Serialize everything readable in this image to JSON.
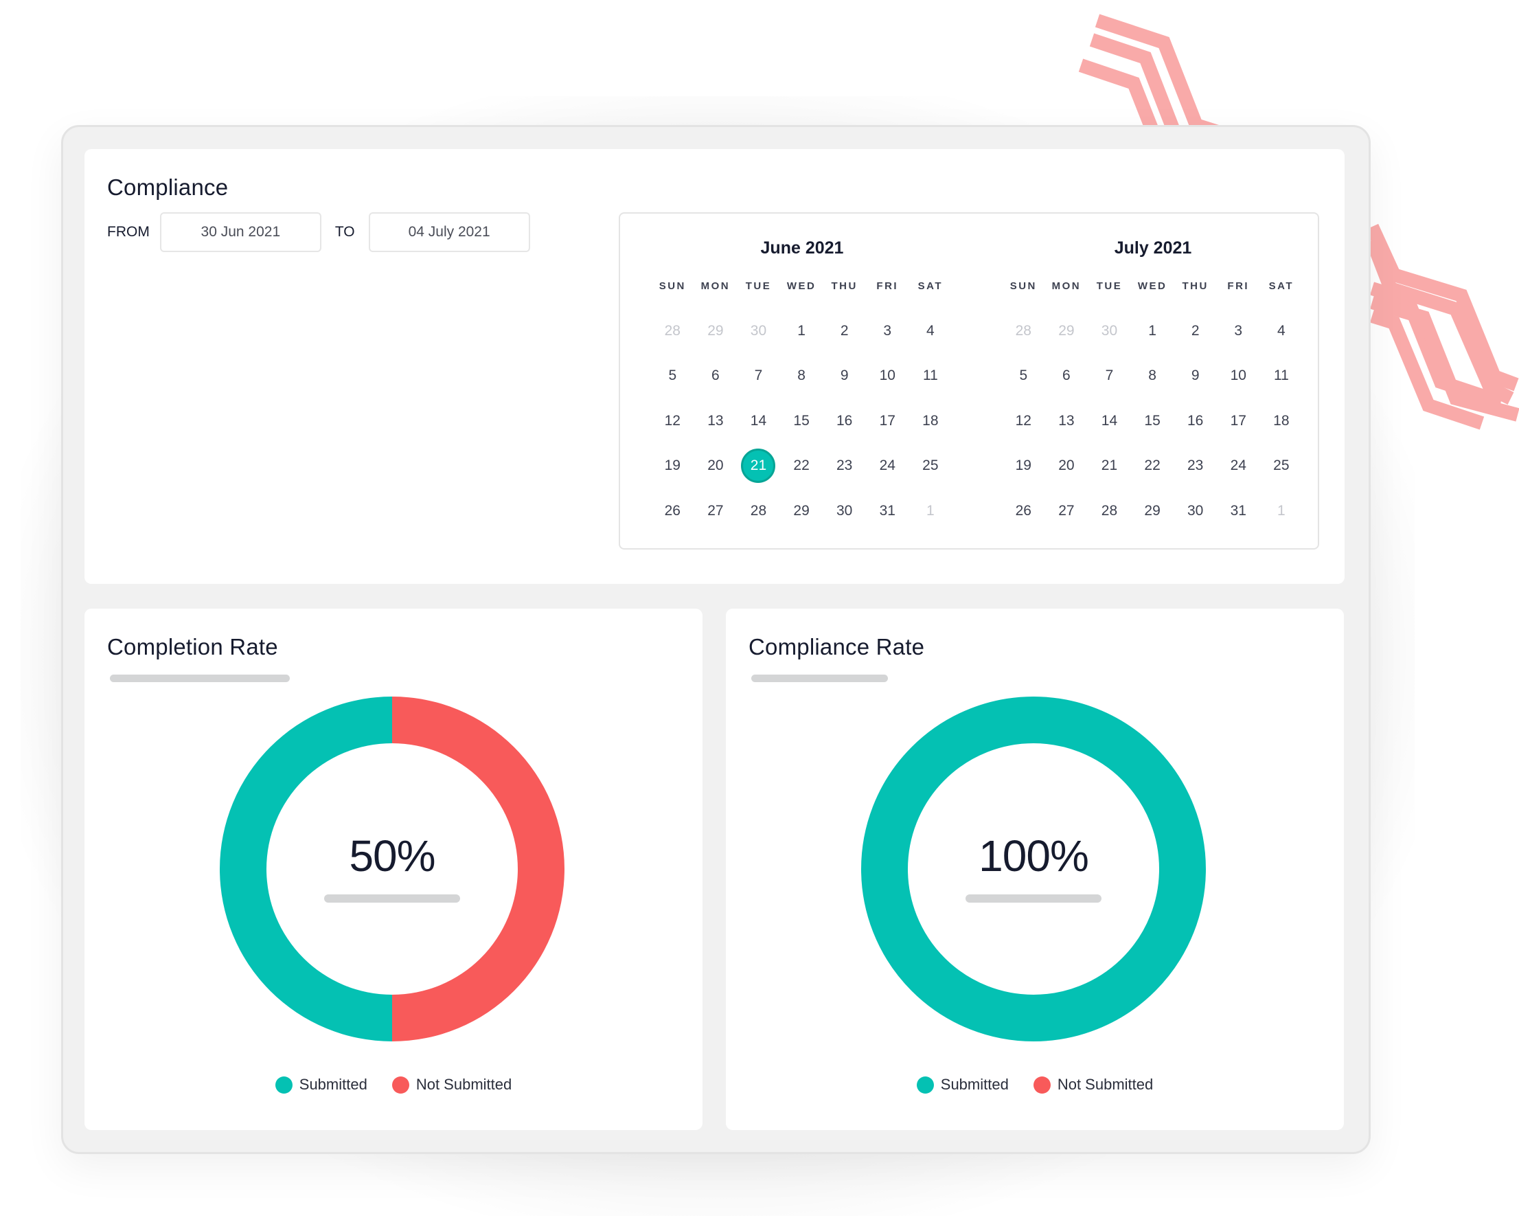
{
  "colors": {
    "accent": "#04c1b3",
    "negative": "#f85a5a",
    "decoration": "#f9aaa9",
    "text": "#161b2e"
  },
  "compliance": {
    "title": "Compliance",
    "from_label": "FROM",
    "from_value": "30 Jun 2021",
    "to_label": "TO",
    "to_value": "04 July 2021"
  },
  "calendar": {
    "weekdays": [
      "SUN",
      "MON",
      "TUE",
      "WED",
      "THU",
      "FRI",
      "SAT"
    ],
    "months": [
      {
        "title": "June 2021",
        "days": [
          {
            "d": "28",
            "muted": true
          },
          {
            "d": "29",
            "muted": true
          },
          {
            "d": "30",
            "muted": true
          },
          {
            "d": "1"
          },
          {
            "d": "2"
          },
          {
            "d": "3"
          },
          {
            "d": "4"
          },
          {
            "d": "5"
          },
          {
            "d": "6"
          },
          {
            "d": "7"
          },
          {
            "d": "8"
          },
          {
            "d": "9"
          },
          {
            "d": "10"
          },
          {
            "d": "11"
          },
          {
            "d": "12"
          },
          {
            "d": "13"
          },
          {
            "d": "14"
          },
          {
            "d": "15"
          },
          {
            "d": "16"
          },
          {
            "d": "17"
          },
          {
            "d": "18"
          },
          {
            "d": "19"
          },
          {
            "d": "20"
          },
          {
            "d": "21",
            "selected": true
          },
          {
            "d": "22"
          },
          {
            "d": "23"
          },
          {
            "d": "24"
          },
          {
            "d": "25"
          },
          {
            "d": "26"
          },
          {
            "d": "27"
          },
          {
            "d": "28"
          },
          {
            "d": "29"
          },
          {
            "d": "30"
          },
          {
            "d": "31"
          },
          {
            "d": "1",
            "muted": true
          }
        ]
      },
      {
        "title": "July 2021",
        "days": [
          {
            "d": "28",
            "muted": true
          },
          {
            "d": "29",
            "muted": true
          },
          {
            "d": "30",
            "muted": true
          },
          {
            "d": "1"
          },
          {
            "d": "2"
          },
          {
            "d": "3"
          },
          {
            "d": "4"
          },
          {
            "d": "5"
          },
          {
            "d": "6"
          },
          {
            "d": "7"
          },
          {
            "d": "8"
          },
          {
            "d": "9"
          },
          {
            "d": "10"
          },
          {
            "d": "11"
          },
          {
            "d": "12"
          },
          {
            "d": "13"
          },
          {
            "d": "14"
          },
          {
            "d": "15"
          },
          {
            "d": "16"
          },
          {
            "d": "17"
          },
          {
            "d": "18"
          },
          {
            "d": "19"
          },
          {
            "d": "20"
          },
          {
            "d": "21"
          },
          {
            "d": "22"
          },
          {
            "d": "23"
          },
          {
            "d": "24"
          },
          {
            "d": "25"
          },
          {
            "d": "26"
          },
          {
            "d": "27"
          },
          {
            "d": "28"
          },
          {
            "d": "29"
          },
          {
            "d": "30"
          },
          {
            "d": "31"
          },
          {
            "d": "1",
            "muted": true
          }
        ]
      }
    ]
  },
  "rates": [
    {
      "title": "Completion Rate",
      "value_label": "50%",
      "legend": [
        {
          "label": "Submitted",
          "color": "#04c1b3"
        },
        {
          "label": "Not Submitted",
          "color": "#f85a5a"
        }
      ]
    },
    {
      "title": "Compliance Rate",
      "value_label": "100%",
      "legend": [
        {
          "label": "Submitted",
          "color": "#04c1b3"
        },
        {
          "label": "Not Submitted",
          "color": "#f85a5a"
        }
      ]
    }
  ],
  "chart_data": [
    {
      "type": "pie",
      "title": "Completion Rate",
      "categories": [
        "Submitted",
        "Not Submitted"
      ],
      "values": [
        50,
        50
      ],
      "center_label": "50%",
      "legend": "bottom"
    },
    {
      "type": "pie",
      "title": "Compliance Rate",
      "categories": [
        "Submitted",
        "Not Submitted"
      ],
      "values": [
        100,
        0
      ],
      "center_label": "100%",
      "legend": "bottom"
    }
  ]
}
